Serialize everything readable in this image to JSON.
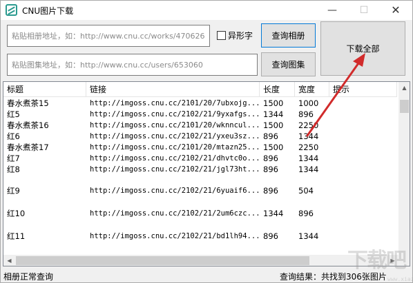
{
  "window": {
    "title": "CNU图片下载",
    "icons": {
      "app": "cnu-app-icon",
      "minimize": "minimize-icon",
      "maximize": "maximize-icon",
      "close": "close-icon"
    },
    "min_glyph": "—",
    "max_glyph": "☐",
    "close_glyph": "✕"
  },
  "inputs": {
    "album_placeholder": "粘贴相册地址，如：http://www.cnu.cc/works/470626",
    "set_placeholder": "粘贴图集地址，如：http://www.cnu.cc/users/653060"
  },
  "variant": {
    "label": "异形字",
    "checked": false
  },
  "buttons": {
    "query_album": "查询相册",
    "query_set": "查询图集",
    "download_all": "下载全部"
  },
  "table": {
    "columns": [
      "标题",
      "链接",
      "长度",
      "宽度",
      "提示"
    ],
    "rows": [
      {
        "title": "春水煮茶15",
        "link": "http://imgoss.cnu.cc/2101/20/7ubxojg...",
        "length": "1500",
        "width": "1000",
        "tip": ""
      },
      {
        "title": "红5",
        "link": "http://imgoss.cnu.cc/2102/21/9yxafgs...",
        "length": "1344",
        "width": "896",
        "tip": ""
      },
      {
        "title": "春水煮茶16",
        "link": "http://imgoss.cnu.cc/2101/20/wknncul...",
        "length": "1500",
        "width": "2250",
        "tip": ""
      },
      {
        "title": "红6",
        "link": "http://imgoss.cnu.cc/2102/21/yxeu3sz...",
        "length": "896",
        "width": "1344",
        "tip": ""
      },
      {
        "title": "春水煮茶17",
        "link": "http://imgoss.cnu.cc/2101/20/mtazn25...",
        "length": "1500",
        "width": "2250",
        "tip": ""
      },
      {
        "title": "红7",
        "link": "http://imgoss.cnu.cc/2102/21/dhvtc0o...",
        "length": "896",
        "width": "1344",
        "tip": ""
      },
      {
        "title": "红8",
        "link": "http://imgoss.cnu.cc/2102/21/jgl73ht...",
        "length": "896",
        "width": "1344",
        "tip": ""
      },
      {
        "title": "红9",
        "link": "http://imgoss.cnu.cc/2102/21/6yuaif6...",
        "length": "896",
        "width": "504",
        "tip": ""
      },
      {
        "title": "红10",
        "link": "http://imgoss.cnu.cc/2102/21/2um6czc...",
        "length": "1344",
        "width": "896",
        "tip": ""
      },
      {
        "title": "红11",
        "link": "http://imgoss.cnu.cc/2102/21/bd1lh94...",
        "length": "896",
        "width": "1344",
        "tip": ""
      }
    ]
  },
  "status": {
    "left": "相册正常查询",
    "right": "查询结果：共找到306张图片"
  },
  "annotation": {
    "arrow_color": "#d12b2b"
  },
  "watermark": {
    "text": "下载吧",
    "url": "www.xiazaiba.com"
  }
}
